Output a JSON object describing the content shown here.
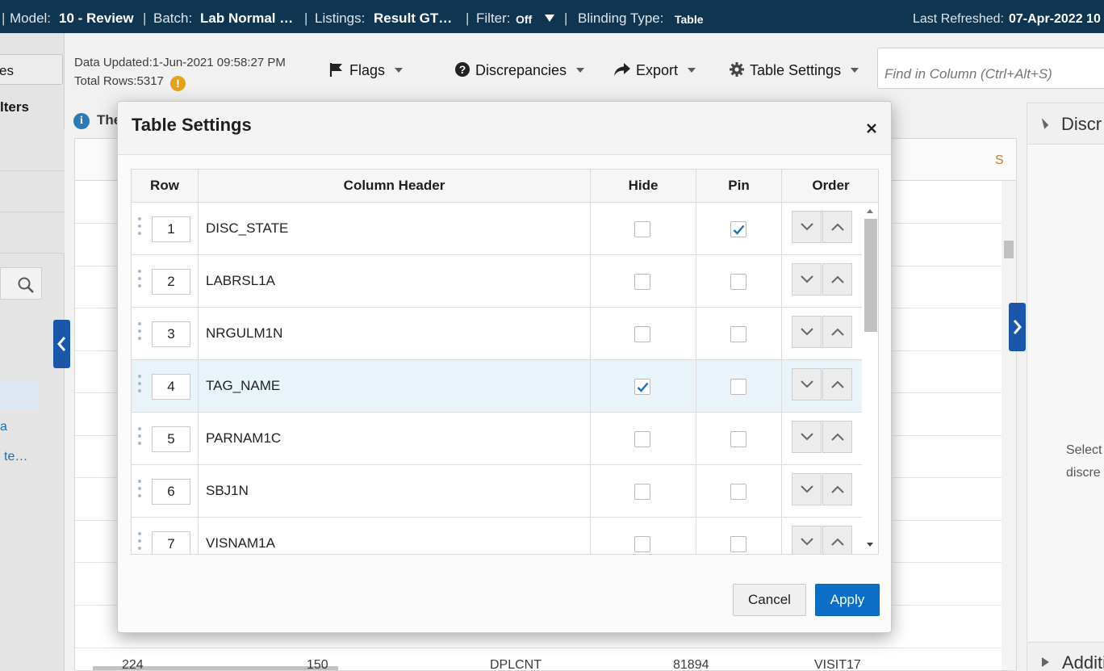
{
  "topbar": {
    "model_label": "Model:",
    "model_value": "10 - Review",
    "batch_label": "Batch:",
    "batch_value": "Lab Normal …",
    "listings_label": "Listings:",
    "listings_value": "Result GT…",
    "filter_label": "Filter:",
    "filter_value": "Off",
    "blinding_label": "Blinding Type:",
    "blinding_value": "Table",
    "refreshed_label": "Last Refreshed:",
    "refreshed_value": "07-Apr-2022 10"
  },
  "left_panel": {
    "button_label": "es",
    "filters_label": "lters",
    "link1": "a",
    "link2": "te…"
  },
  "toolbar": {
    "data_updated_label": "Data Updated:",
    "data_updated_value": "1-Jun-2021 09:58:27 PM",
    "total_rows_label": "Total Rows:",
    "total_rows_value": "5317",
    "warn_glyph": "!",
    "flags": "Flags",
    "discrepancies": "Discrepancies",
    "export": "Export",
    "table_settings": "Table Settings",
    "find_placeholder": "Find in Column (Ctrl+Alt+S)"
  },
  "background": {
    "info_glyph": "i",
    "info_text": "The",
    "header_right": "S",
    "row_cells": [
      "224",
      "150",
      "DPLCNT",
      "81894",
      "VISIT17"
    ]
  },
  "right_panel": {
    "title": "Discr",
    "text1": "Select",
    "text2": "discre",
    "additional": "Additi"
  },
  "dialog": {
    "title": "Table Settings",
    "columns": {
      "row": "Row",
      "header": "Column Header",
      "hide": "Hide",
      "pin": "Pin",
      "order": "Order"
    },
    "rows": [
      {
        "num": "1",
        "name": "DISC_STATE",
        "hide": false,
        "pin": true
      },
      {
        "num": "2",
        "name": "LABRSL1A",
        "hide": false,
        "pin": false
      },
      {
        "num": "3",
        "name": "NRGULM1N",
        "hide": false,
        "pin": false
      },
      {
        "num": "4",
        "name": "TAG_NAME",
        "hide": true,
        "pin": false
      },
      {
        "num": "5",
        "name": "PARNAM1C",
        "hide": false,
        "pin": false
      },
      {
        "num": "6",
        "name": "SBJ1N",
        "hide": false,
        "pin": false
      },
      {
        "num": "7",
        "name": "VISNAM1A",
        "hide": false,
        "pin": false
      }
    ],
    "selected_row": "4",
    "cancel": "Cancel",
    "apply": "Apply"
  },
  "colors": {
    "topbar": "#0f3550",
    "accent": "#0b6fc6",
    "toggle": "#1a57a9",
    "warning": "#e3a21a",
    "selected_row": "#e9f4fa"
  }
}
